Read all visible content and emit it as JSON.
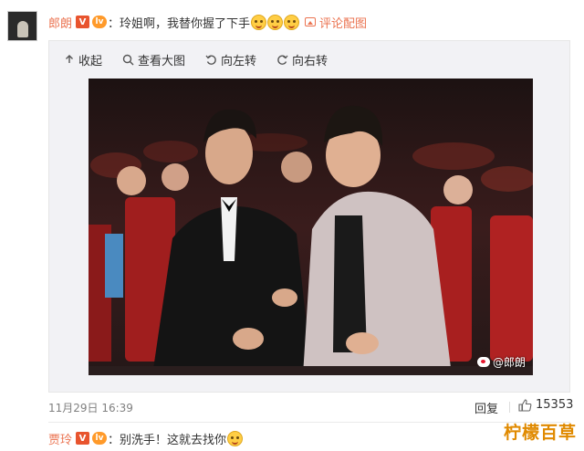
{
  "post": {
    "username": "郎朗",
    "verified_badge": "V",
    "level_badge": "lv",
    "text": "：玲姐啊，我替你握了下手",
    "pic_link": "评论配图"
  },
  "toolbar": {
    "collapse": "收起",
    "view_large": "查看大图",
    "rotate_left": "向左转",
    "rotate_right": "向右转"
  },
  "photo": {
    "watermark": "@郎朗"
  },
  "footer": {
    "timestamp": "11月29日 16:39",
    "reply": "回复",
    "like_count": "15353"
  },
  "reply_comment": {
    "username": "贾玲",
    "verified_badge": "V",
    "level_badge": "lv",
    "text": "：别洗手！这就去找你"
  },
  "site_watermark": "柠檬百草",
  "colors": {
    "username": "#eb7350",
    "badge_red": "#e8542e",
    "badge_orange": "#ff9a2a",
    "link": "#eb7350"
  }
}
